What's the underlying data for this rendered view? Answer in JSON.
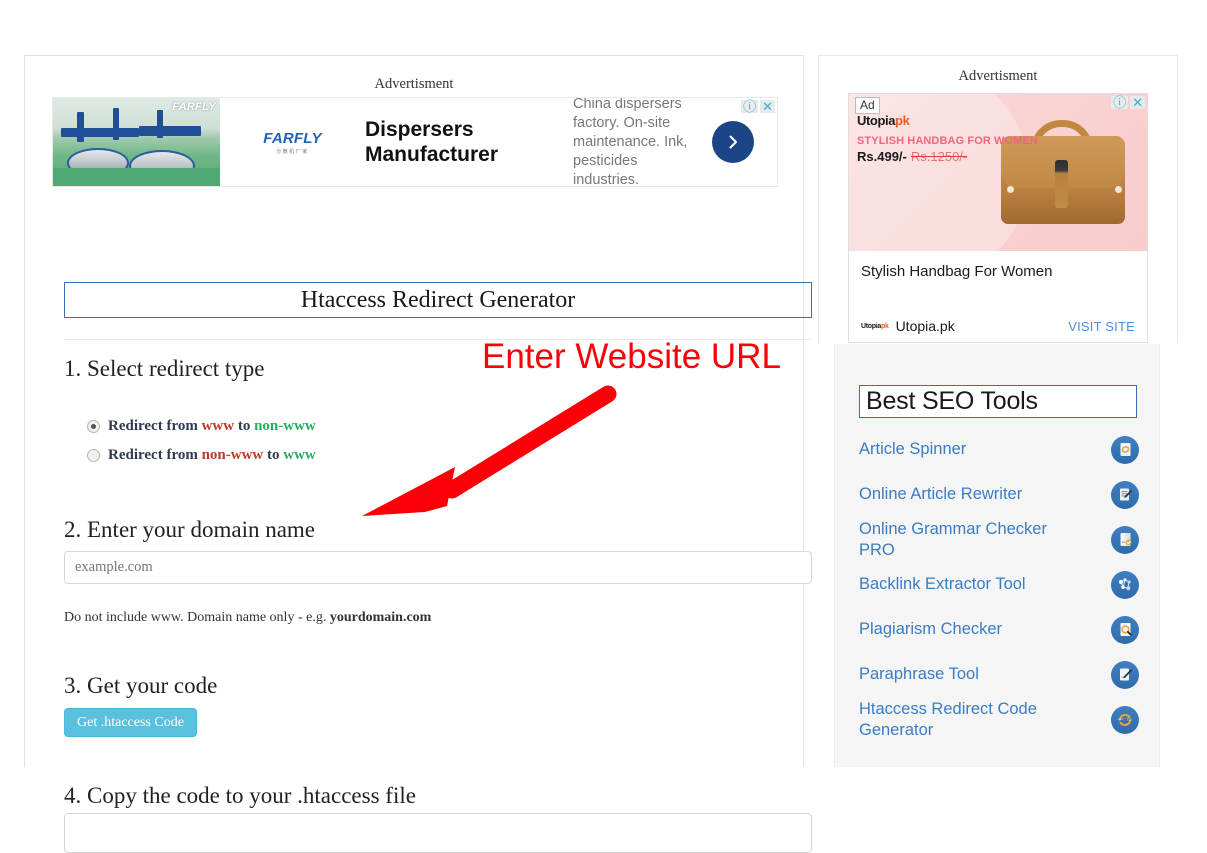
{
  "left_panel": {
    "ad_label": "Advertisment",
    "banner_ad": {
      "brand": "FARFLY",
      "brand_sub": "分散机厂家",
      "headline": "Dispersers Manufacturer",
      "description": "China dispersers factory. On-site maintenance. Ink, pesticides industries.",
      "cta_icon": "chevron-right-icon",
      "info_icon": "ⓘ",
      "close_icon": "✕"
    },
    "title": "Htaccess Redirect Generator",
    "step1": {
      "heading": "1. Select redirect type",
      "options": [
        {
          "prefix": "Redirect from ",
          "from": "www",
          "mid": " to ",
          "to": "non-www",
          "selected": true
        },
        {
          "prefix": "Redirect from ",
          "from": "non-www",
          "mid": " to ",
          "to": "www",
          "selected": false
        }
      ]
    },
    "step2": {
      "heading": "2. Enter your domain name",
      "input_value": "",
      "input_placeholder": "example.com",
      "hint_prefix": "Do not include www. Domain name only - e.g. ",
      "hint_bold": "yourdomain.com"
    },
    "step3": {
      "heading": "3. Get your code",
      "button_label": "Get .htaccess Code"
    },
    "step4": {
      "heading": "4. Copy the code to your .htaccess file",
      "code_value": ""
    }
  },
  "right_panel": {
    "ad_label": "Advertisment",
    "ad": {
      "badge": "Ad",
      "logo_main": "Utopia",
      "logo_accent": "pk",
      "tagline": "STYLISH HANDBAG FOR WOMEN",
      "price": "Rs.499/-",
      "price_old": "Rs.1250/-",
      "title": "Stylish Handbag For Women",
      "advertiser": "Utopia.pk",
      "cta": "VISIT SITE",
      "info_icon": "ⓘ",
      "close_icon": "✕"
    },
    "seo_tools": {
      "title": "Best SEO Tools",
      "items": [
        {
          "label": "Article Spinner",
          "icon": "article-spinner-icon"
        },
        {
          "label": "Online Article Rewriter",
          "icon": "article-rewriter-icon"
        },
        {
          "label": "Online Grammar Checker PRO",
          "icon": "grammar-checker-icon"
        },
        {
          "label": "Backlink Extractor Tool",
          "icon": "backlink-extractor-icon"
        },
        {
          "label": "Plagiarism Checker",
          "icon": "plagiarism-checker-icon"
        },
        {
          "label": "Paraphrase Tool",
          "icon": "paraphrase-tool-icon"
        },
        {
          "label": "Htaccess Redirect Code Generator",
          "icon": "htaccess-redirect-icon"
        }
      ]
    }
  },
  "annotation": {
    "text": "Enter Website URL",
    "color": "#fb0007",
    "arrow": "red-arrow-pointing-to-domain-input"
  },
  "colors": {
    "accent_blue": "#3c6eb4",
    "link_blue": "#3a7cc4",
    "button_blue": "#5bc0de",
    "annotation_red": "#fb0007",
    "www_red": "#c0392b",
    "www_green": "#27ae60"
  }
}
